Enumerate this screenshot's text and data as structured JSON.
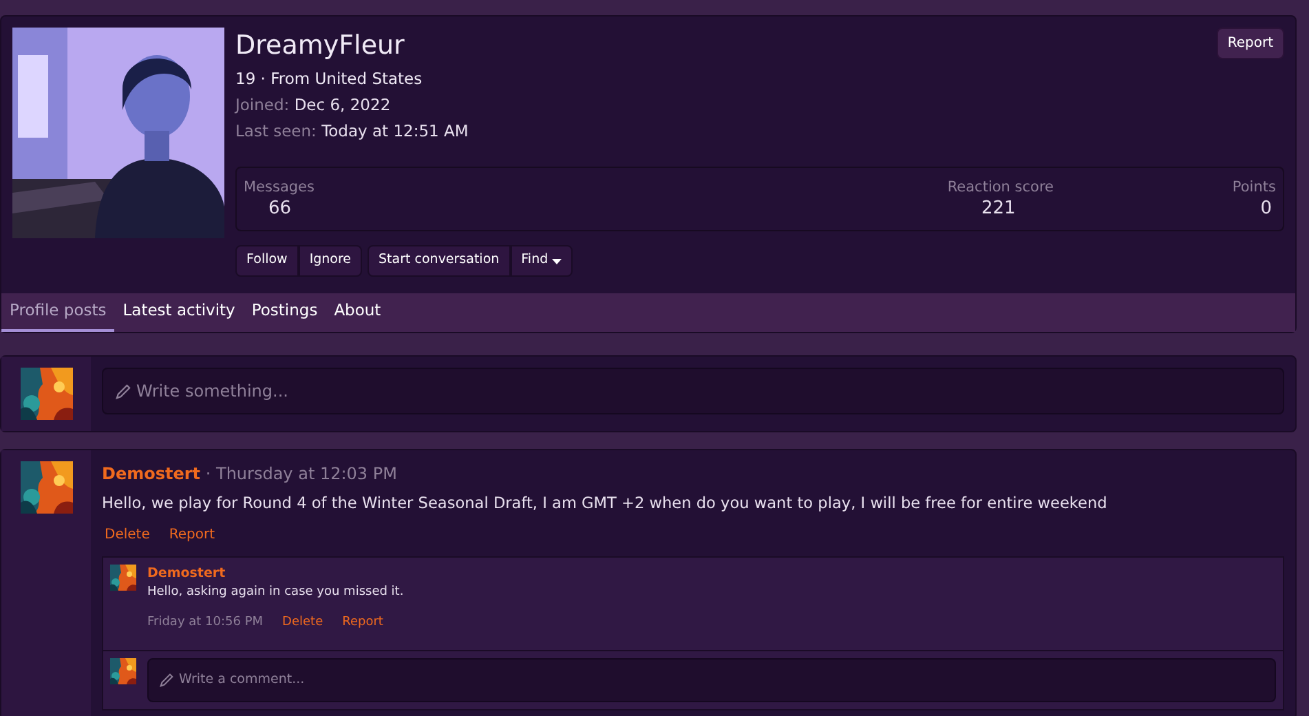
{
  "profile": {
    "kind": "picture",
    "name": "DreamyFleur",
    "subtitle": "19 · From United States",
    "joined_label": "Joined:",
    "joined": "Dec 6, 2022",
    "last_seen_label": "Last seen:",
    "last_seen": "Today at 12:51 AM",
    "report": "Report",
    "stats": [
      {
        "label": "Messages",
        "value": "66"
      },
      {
        "label": "Reaction score",
        "value": "221"
      },
      {
        "label": "Points",
        "value": "0"
      }
    ],
    "actions": [
      [
        "Follow",
        "Ignore"
      ],
      [
        "Start conversation",
        "Find"
      ]
    ]
  },
  "tabs": [
    {
      "label": "Profile posts",
      "selected": true
    },
    {
      "label": "Latest activity",
      "selected": false
    },
    {
      "label": "Postings",
      "selected": false
    },
    {
      "label": "About",
      "selected": false
    }
  ],
  "composer": {
    "placeholder": "Write something..."
  },
  "post": {
    "author": "Demostert",
    "time": "· Thursday at 12:03 PM",
    "text": "Hello, we play for Round 4 of the Winter Seasonal Draft, I am GMT +2 when do you want to play, I will be free for entire weekend",
    "links": [
      "Delete",
      "Report"
    ],
    "comment": {
      "author": "Demostert",
      "text": "Hello, asking again in case you missed it.",
      "time": "Friday at 10:56 PM",
      "links": [
        "Delete",
        "Report"
      ]
    },
    "reply": {
      "placeholder": "Write a comment..."
    }
  }
}
